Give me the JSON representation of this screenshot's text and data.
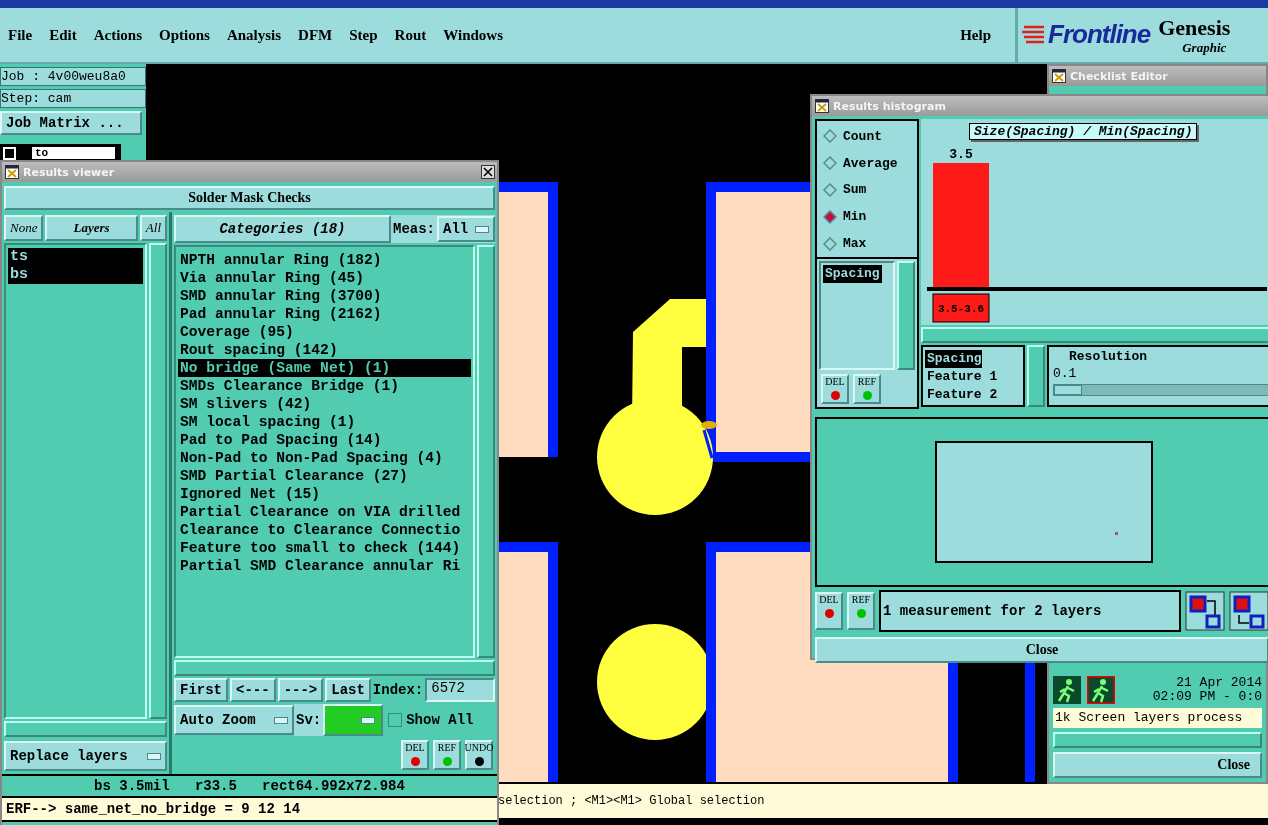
{
  "menu": [
    "File",
    "Edit",
    "Actions",
    "Options",
    "Analysis",
    "DFM",
    "Step",
    "Rout",
    "Windows"
  ],
  "help": "Help",
  "logo": {
    "brand": "Frontline",
    "product": "Genesis",
    "subtitle": "Graphic"
  },
  "job_panel": {
    "job": "Job : 4v00weu8a0",
    "step": "Step: cam",
    "matrix_button": "Job Matrix ...",
    "filter": {
      "checked": false,
      "value": "to"
    }
  },
  "results_viewer": {
    "title": "Results viewer",
    "header": "Solder Mask Checks",
    "layer_buttons": [
      "None",
      "Layers",
      "All"
    ],
    "layers": [
      {
        "name": "ts",
        "selected": true
      },
      {
        "name": "bs",
        "selected": true
      }
    ],
    "categories_button": "Categories (18)",
    "meas_label": "Meas:",
    "meas_value": "All",
    "categories": [
      {
        "label": "NPTH annular Ring (182)",
        "selected": false
      },
      {
        "label": "Via annular Ring (45)",
        "selected": false
      },
      {
        "label": "SMD annular Ring (3700)",
        "selected": false
      },
      {
        "label": "Pad annular Ring (2162)",
        "selected": false
      },
      {
        "label": "Coverage (95)",
        "selected": false
      },
      {
        "label": "Rout spacing (142)",
        "selected": false
      },
      {
        "label": "No bridge (Same Net) (1)",
        "selected": true
      },
      {
        "label": "SMDs Clearance Bridge (1)",
        "selected": false
      },
      {
        "label": "SM slivers (42)",
        "selected": false
      },
      {
        "label": "SM local spacing (1)",
        "selected": false
      },
      {
        "label": "Pad to Pad Spacing (14)",
        "selected": false
      },
      {
        "label": "Non-Pad to Non-Pad Spacing (4)",
        "selected": false
      },
      {
        "label": "SMD Partial Clearance (27)",
        "selected": false
      },
      {
        "label": "Ignored Net (15)",
        "selected": false
      },
      {
        "label": "Partial Clearance on VIA drilled",
        "selected": false
      },
      {
        "label": "Clearance to Clearance Connectio",
        "selected": false
      },
      {
        "label": "Feature too small to check (144)",
        "selected": false
      },
      {
        "label": "Partial SMD Clearance annular Ri",
        "selected": false
      }
    ],
    "nav_buttons": [
      "First",
      "<---",
      "--->",
      "Last"
    ],
    "index_label": "Index:",
    "index_value": "6572",
    "zoom_menu": "Auto Zoom",
    "sv_label": "Sv:",
    "show_all": {
      "label": "Show All",
      "checked": false
    },
    "replace_menu": "Replace layers",
    "tool_buttons": [
      "DEL",
      "REF",
      "UNDO"
    ],
    "feature_info": "bs 3.5mil   r33.5   rect64.992x72.984",
    "message": "ERF--> same_net_no_bridge = 9 12 14"
  },
  "histogram": {
    "title": "Results histogram",
    "modes": [
      {
        "label": "Count",
        "selected": false
      },
      {
        "label": "Average",
        "selected": false
      },
      {
        "label": "Sum",
        "selected": false
      },
      {
        "label": "Min",
        "selected": true
      },
      {
        "label": "Max",
        "selected": false
      }
    ],
    "attributes": [
      {
        "label": "Spacing",
        "selected": true
      }
    ],
    "chart_title": "Size(Spacing) / Min(Spacing)",
    "bins": [
      {
        "count_label": "3.5",
        "range": "3.5-3.6"
      }
    ],
    "columns": [
      {
        "label": "Spacing",
        "selected": true
      },
      {
        "label": "Feature 1",
        "selected": false
      },
      {
        "label": "Feature 2",
        "selected": false
      }
    ],
    "resolution_label": "Resolution",
    "resolution_value": "0.1",
    "resolution_slider": {
      "level": 0
    },
    "side_buttons": [
      "DEL",
      "REF"
    ],
    "buttons": [
      "DEL",
      "REF"
    ],
    "summary": "1 measurement for 2 layers",
    "close": "Close"
  },
  "checklist_editor": {
    "title": "Checklist Editor",
    "date": "21 Apr 2014",
    "time": "02:09 PM - 0:0",
    "log": "1k Screen layers process",
    "close": "Close"
  },
  "status_line": "selection ; <M1><M1> Global selection"
}
